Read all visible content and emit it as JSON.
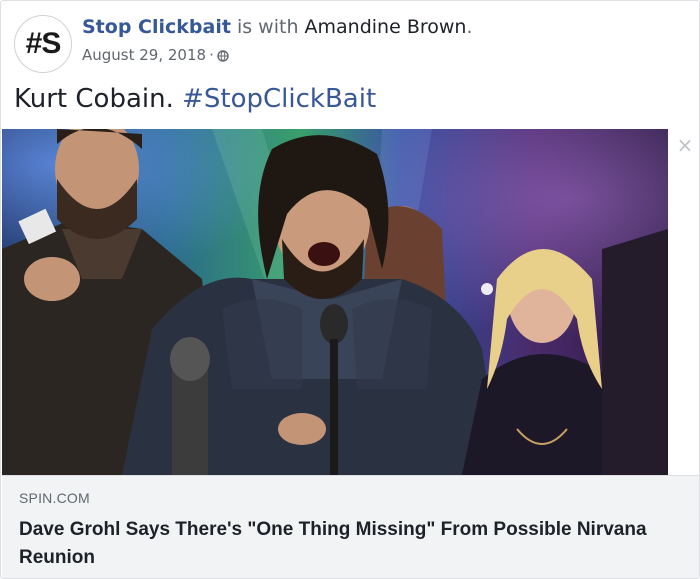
{
  "post": {
    "avatar_text": "#S",
    "page_name": "Stop Clickbait",
    "with_text": " is with ",
    "tagged_name": "Amandine Brown",
    "tagged_suffix": ".",
    "date": "August 29, 2018",
    "separator": "·",
    "privacy_icon": "globe-icon",
    "message": "Kurt Cobain.",
    "hashtag": "#StopClickBait"
  },
  "link_preview": {
    "image": "photo-dave-grohl-on-stage",
    "close_icon": "×",
    "domain": "SPIN.COM",
    "title": "Dave Grohl Says There's \"One Thing Missing\" From Possible Nirvana Reunion"
  },
  "colors": {
    "link_blue": "#365899",
    "hashtag_blue": "#385898",
    "meta_gray": "#606770",
    "preview_bg": "#f2f3f5"
  }
}
